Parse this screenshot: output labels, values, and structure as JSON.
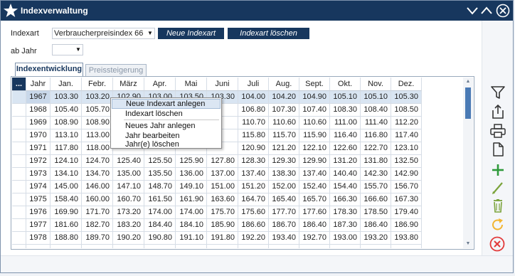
{
  "window": {
    "title": "Indexverwaltung"
  },
  "form": {
    "indexart_label": "Indexart",
    "indexart_value": "Verbraucherpreisindex 66",
    "new_button": "Neue Indexart",
    "delete_button": "Indexart löschen",
    "abjahr_label": "ab Jahr",
    "abjahr_value": ""
  },
  "tabs": [
    {
      "label": "Indexentwicklung",
      "active": true
    },
    {
      "label": "Preissteigerung",
      "active": false
    }
  ],
  "table": {
    "corner": "...",
    "columns": [
      "Jahr",
      "Jan.",
      "Febr.",
      "März",
      "Apr.",
      "Mai",
      "Juni",
      "Juli",
      "Aug.",
      "Sept.",
      "Okt.",
      "Nov.",
      "Dez."
    ],
    "selected_row": 0,
    "rows": [
      [
        "1967",
        "103.30",
        "103.20",
        "102.90",
        "103.00",
        "103.50",
        "103.30",
        "104.00",
        "104.20",
        "104.90",
        "105.10",
        "105.10",
        "105.30"
      ],
      [
        "1968",
        "105.40",
        "105.70",
        "",
        "",
        "",
        "",
        "106.80",
        "107.30",
        "107.40",
        "108.30",
        "108.40",
        "108.50"
      ],
      [
        "1969",
        "108.90",
        "108.90",
        "",
        "",
        "",
        "",
        "110.70",
        "110.60",
        "110.60",
        "111.00",
        "111.40",
        "112.20"
      ],
      [
        "1970",
        "113.10",
        "113.00",
        "",
        "",
        "",
        "",
        "115.80",
        "115.70",
        "115.90",
        "116.40",
        "116.80",
        "117.40"
      ],
      [
        "1971",
        "117.80",
        "118.00",
        "",
        "",
        "",
        "",
        "120.90",
        "121.20",
        "122.10",
        "122.60",
        "122.70",
        "123.10"
      ],
      [
        "1972",
        "124.10",
        "124.70",
        "125.40",
        "125.50",
        "125.90",
        "127.80",
        "128.30",
        "129.30",
        "129.90",
        "131.20",
        "131.80",
        "132.50"
      ],
      [
        "1973",
        "134.10",
        "134.70",
        "135.00",
        "135.50",
        "136.00",
        "137.00",
        "137.40",
        "138.30",
        "137.40",
        "140.40",
        "142.30",
        "142.90"
      ],
      [
        "1974",
        "145.00",
        "146.00",
        "147.10",
        "148.70",
        "149.10",
        "151.00",
        "151.20",
        "152.00",
        "152.40",
        "154.40",
        "155.70",
        "156.70"
      ],
      [
        "1975",
        "158.40",
        "160.00",
        "160.70",
        "161.50",
        "161.90",
        "163.60",
        "164.70",
        "165.40",
        "165.70",
        "166.30",
        "166.60",
        "167.30"
      ],
      [
        "1976",
        "169.90",
        "171.70",
        "173.20",
        "174.00",
        "174.00",
        "175.70",
        "175.60",
        "177.70",
        "177.60",
        "178.30",
        "178.50",
        "179.40"
      ],
      [
        "1977",
        "181.60",
        "182.70",
        "183.20",
        "184.40",
        "184.10",
        "185.90",
        "186.60",
        "186.70",
        "186.40",
        "187.30",
        "186.40",
        "186.90"
      ],
      [
        "1978",
        "188.80",
        "189.70",
        "190.20",
        "190.80",
        "191.10",
        "191.80",
        "192.20",
        "193.40",
        "192.70",
        "193.00",
        "193.20",
        "193.80"
      ]
    ]
  },
  "context_menu": {
    "items": [
      {
        "label": "Neue Indexart anlegen",
        "highlighted": true
      },
      {
        "label": "Indexart löschen",
        "highlighted": false
      },
      {
        "label": "Neues Jahr anlegen",
        "highlighted": false
      },
      {
        "label": "Jahr bearbeiten",
        "highlighted": false
      },
      {
        "label": "Jahr(e) löschen",
        "highlighted": false
      }
    ]
  },
  "sidebar_icons": [
    "filter-icon",
    "export-icon",
    "print-icon",
    "new-document-icon",
    "add-icon",
    "edit-icon",
    "delete-icon",
    "refresh-icon",
    "close-icon"
  ],
  "colors": {
    "titlebar": "#17375e",
    "button": "#17375e",
    "selection": "#d9e5f2",
    "add": "#2e9a3a",
    "edit": "#7aa33a",
    "refresh": "#f2b531",
    "close": "#e23a3a"
  }
}
